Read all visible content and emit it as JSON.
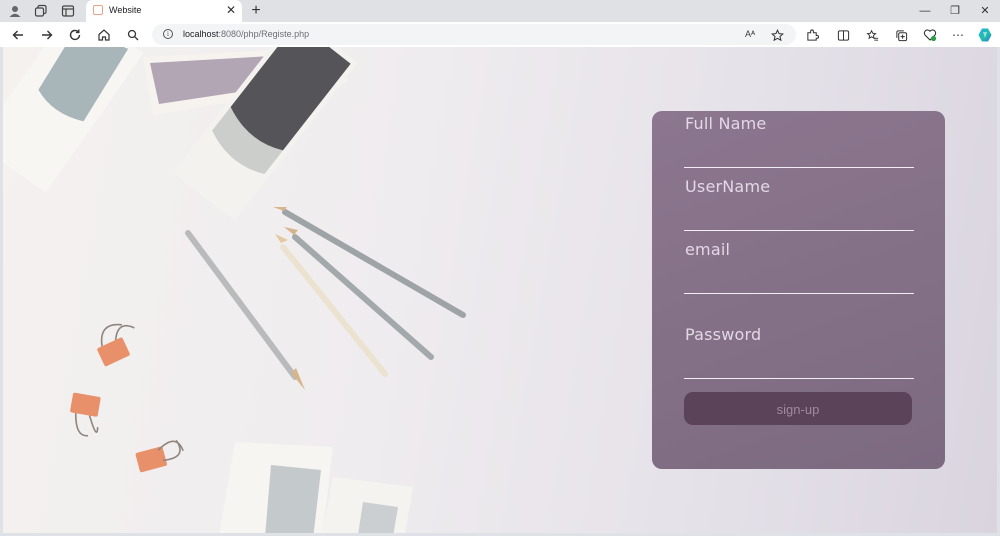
{
  "browser": {
    "tab_title": "Website",
    "tab_close": "✕",
    "new_tab": "+",
    "address_host": "localhost",
    "address_path": ":8080/php/Registe.php",
    "read_aloud": "Aᴬ",
    "window_minimize": "—",
    "window_maximize": "❐",
    "window_close": "✕"
  },
  "form": {
    "fields": [
      {
        "label": "Full Name",
        "value": ""
      },
      {
        "label": "UserName",
        "value": ""
      },
      {
        "label": "email",
        "value": ""
      },
      {
        "label": "Password",
        "value": ""
      }
    ],
    "submit_label": "sign-up"
  },
  "colors": {
    "card": "#857187",
    "button": "#5b4359",
    "button_text": "#9f8b9e",
    "label": "#e3d8e6"
  }
}
